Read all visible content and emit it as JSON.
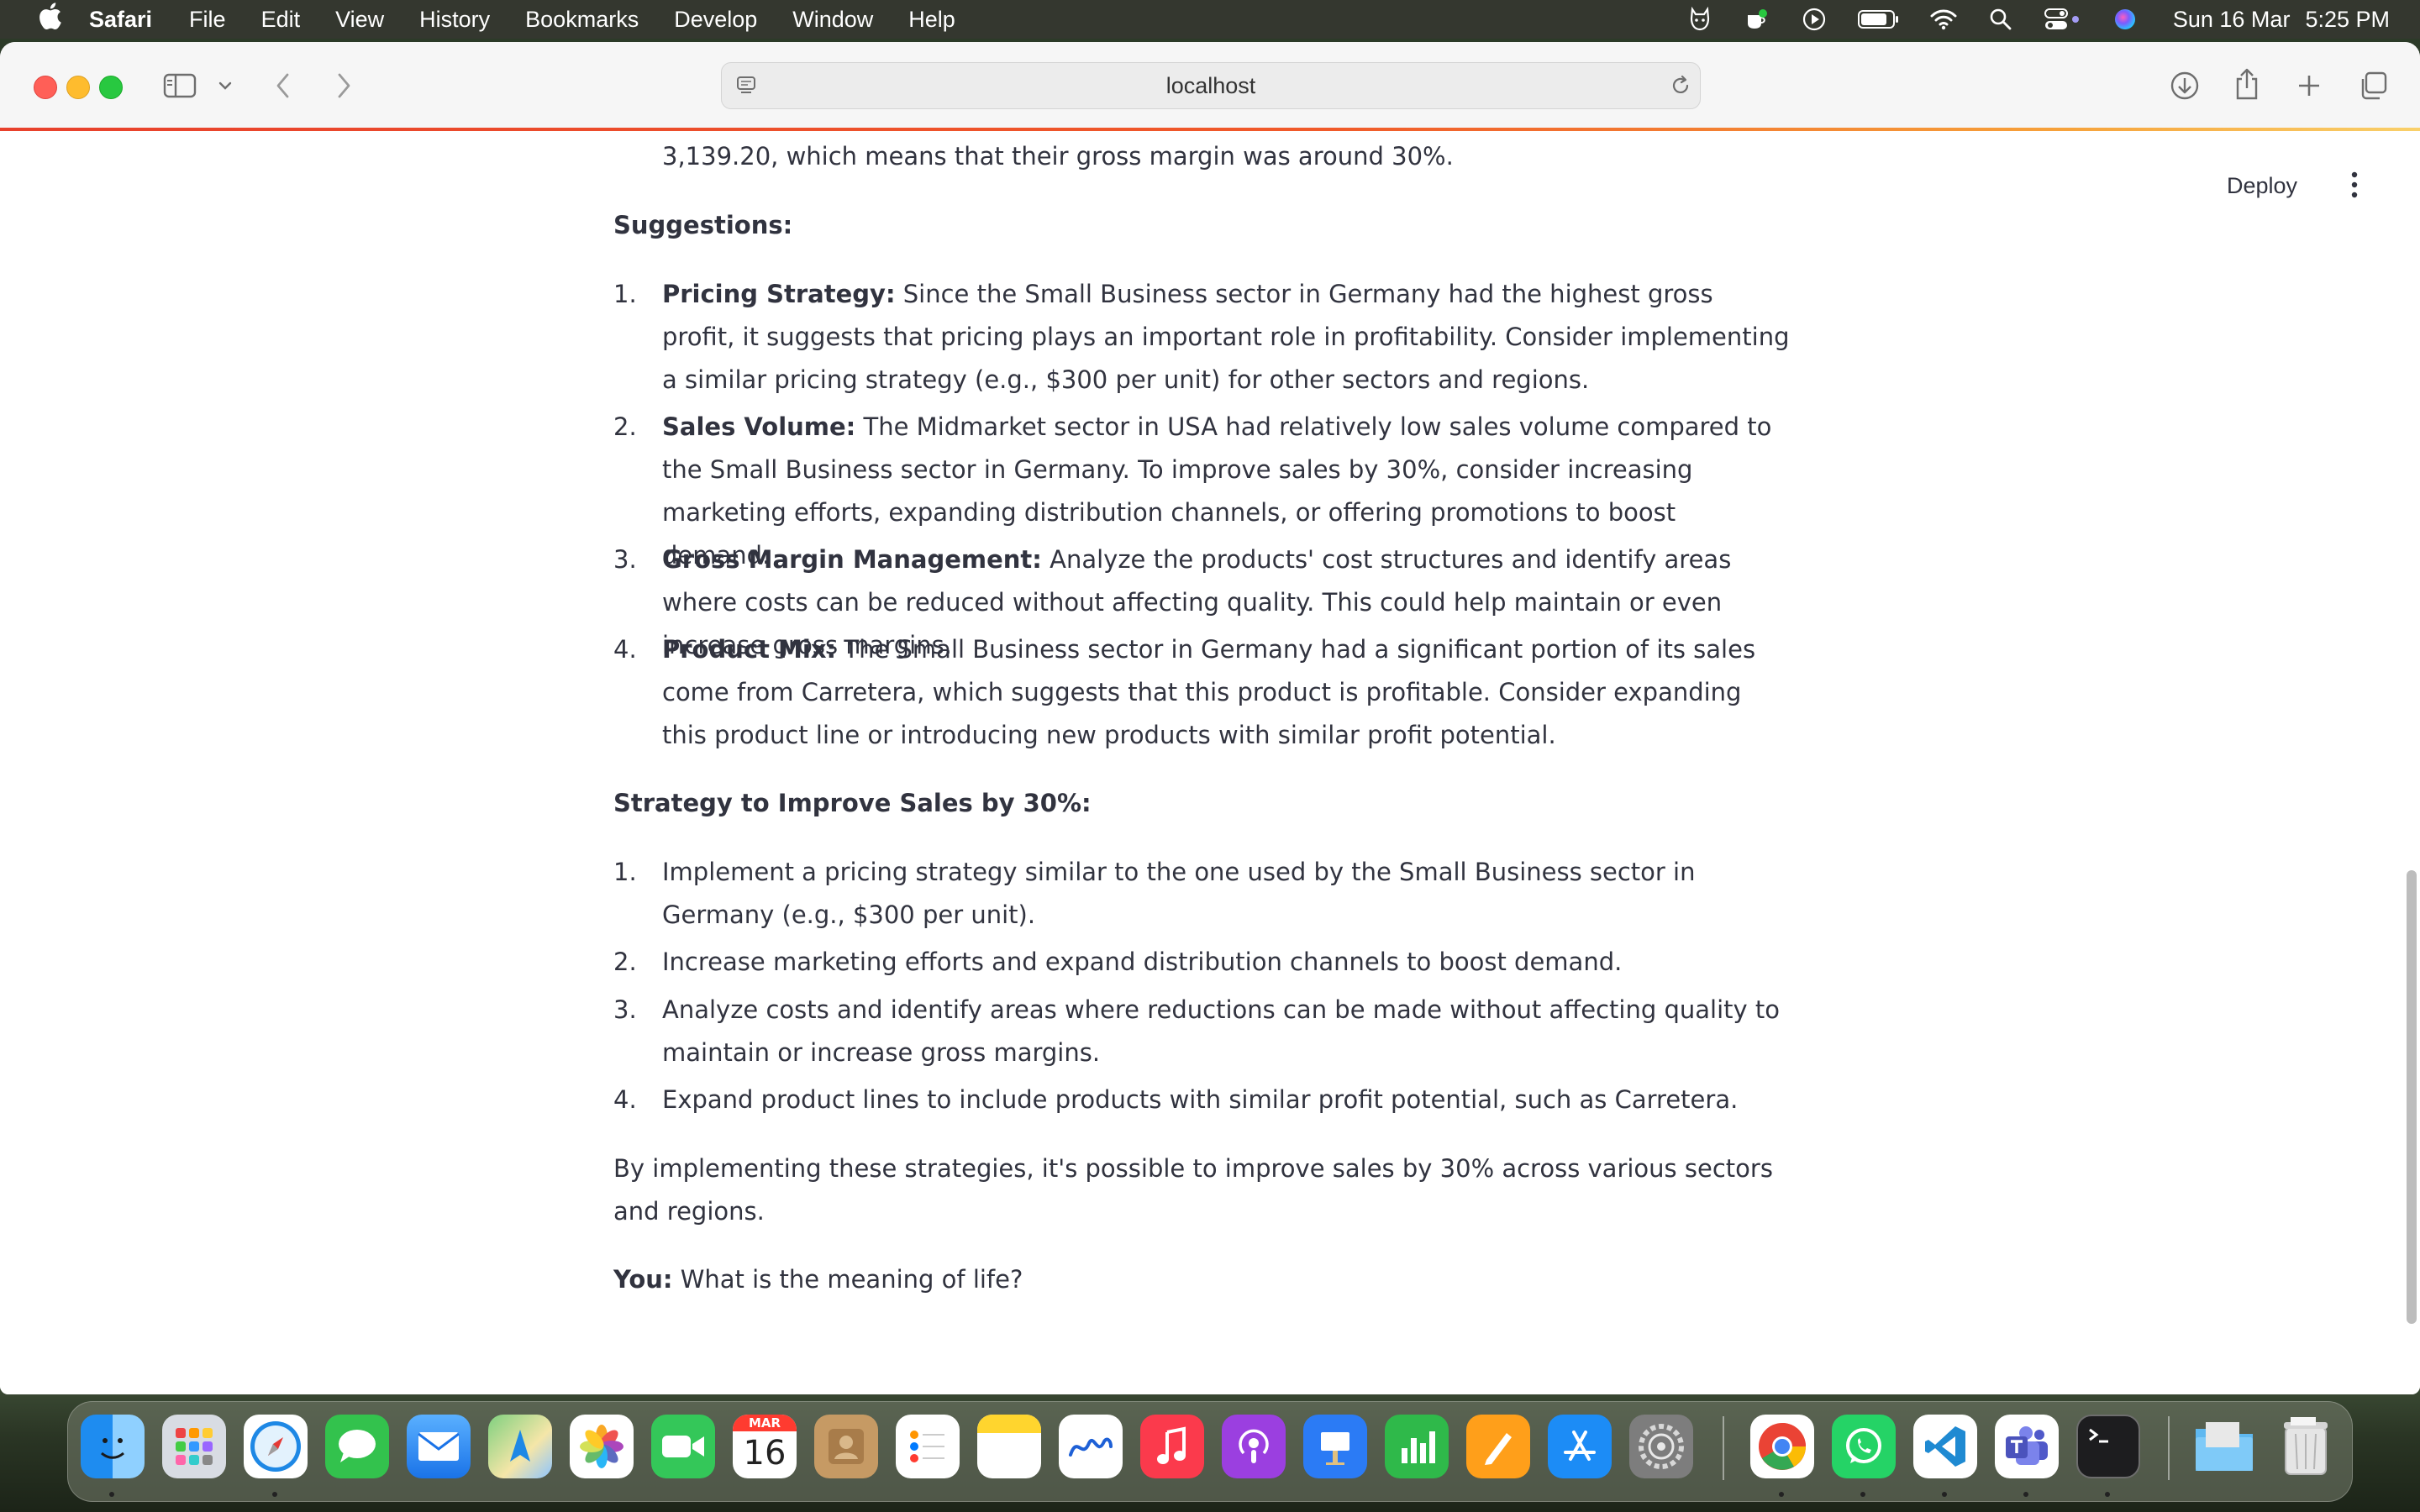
{
  "menubar": {
    "app": "Safari",
    "items": [
      "File",
      "Edit",
      "View",
      "History",
      "Bookmarks",
      "Develop",
      "Window",
      "Help"
    ],
    "date": "Sun 16 Mar",
    "time": "5:25 PM"
  },
  "browser": {
    "url": "localhost"
  },
  "app_header": {
    "deploy_label": "Deploy"
  },
  "content": {
    "intro_tail": "3,139.20, which means that their gross margin was around 30%.",
    "suggestions_heading": "Suggestions:",
    "suggestions": [
      {
        "num": "1.",
        "title": "Pricing Strategy:",
        "text": " Since the Small Business sector in Germany had the highest gross profit, it suggests that pricing plays an important role in profitability. Consider implementing a similar pricing strategy (e.g., $300 per unit) for other sectors and regions."
      },
      {
        "num": "2.",
        "title": "Sales Volume:",
        "text": " The Midmarket sector in USA had relatively low sales volume compared to the Small Business sector in Germany. To improve sales by 30%, consider increasing marketing efforts, expanding distribution channels, or offering promotions to boost demand."
      },
      {
        "num": "3.",
        "title": "Gross Margin Management:",
        "text": " Analyze the products' cost structures and identify areas where costs can be reduced without affecting quality. This could help maintain or even increase gross margins."
      },
      {
        "num": "4.",
        "title": "Product Mix:",
        "text": " The Small Business sector in Germany had a significant portion of its sales come from Carretera, which suggests that this product is profitable. Consider expanding this product line or introducing new products with similar profit potential."
      }
    ],
    "strategy_heading": "Strategy to Improve Sales by 30%:",
    "strategy": [
      {
        "num": "1.",
        "text": "Implement a pricing strategy similar to the one used by the Small Business sector in Germany (e.g., $300 per unit)."
      },
      {
        "num": "2.",
        "text": "Increase marketing efforts and expand distribution channels to boost demand."
      },
      {
        "num": "3.",
        "text": "Analyze costs and identify areas where reductions can be made without affecting quality to maintain or increase gross margins."
      },
      {
        "num": "4.",
        "text": "Expand product lines to include products with similar profit potential, such as Carretera."
      }
    ],
    "conclusion": "By implementing these strategies, it's possible to improve sales by 30% across various sectors and regions.",
    "chat_label": "You:",
    "chat_text": " What is the meaning of life?"
  },
  "dock": {
    "calendar_month": "MAR",
    "calendar_day": "16",
    "apps": [
      "finder",
      "launchpad",
      "safari",
      "messages",
      "mail",
      "maps",
      "photos",
      "facetime",
      "calendar",
      "contacts",
      "reminders",
      "notes",
      "freeform",
      "music",
      "podcasts",
      "keynote",
      "numbers",
      "pages",
      "app-store",
      "system-settings",
      "chrome",
      "whatsapp",
      "vscode",
      "teams",
      "terminal",
      "downloads-folder",
      "trash"
    ]
  }
}
